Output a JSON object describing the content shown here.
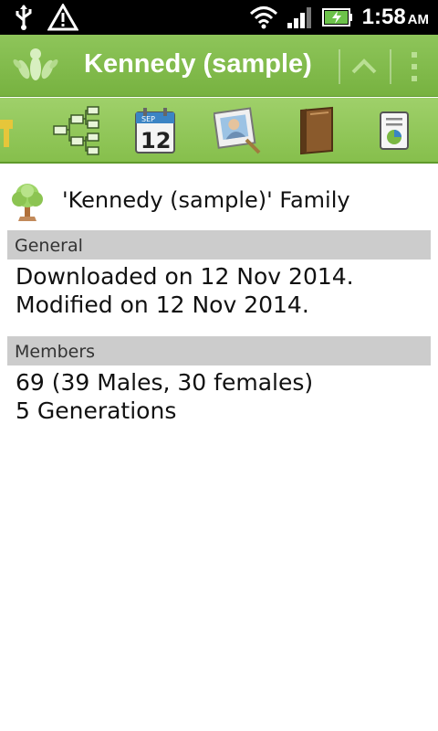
{
  "status_bar": {
    "time": "1:58",
    "ampm": "AM",
    "icons": [
      "usb-icon",
      "warning-icon",
      "wifi-icon",
      "signal-icon",
      "battery-charging-icon"
    ]
  },
  "title_bar": {
    "title": "Kennedy (sample)",
    "icons": [
      "app-logo-icon",
      "chevron-up-icon",
      "overflow-menu-icon"
    ]
  },
  "toolbar": {
    "tools": [
      "key-icon",
      "tree-chart-icon",
      "calendar-icon",
      "photo-icon",
      "book-icon",
      "report-icon"
    ],
    "calendar_month": "SEP",
    "calendar_day": "12"
  },
  "family": {
    "name": "'Kennedy (sample)' Family",
    "icon": "family-tree-icon"
  },
  "sections": {
    "general": {
      "header": "General",
      "lines": [
        "Downloaded on 12 Nov 2014.",
        "Modified on 12 Nov 2014."
      ]
    },
    "members": {
      "header": "Members",
      "lines": [
        "69 (39 Males, 30 females)",
        "5 Generations"
      ]
    }
  },
  "colors": {
    "accent": "#7ab843",
    "header_bg": "#cccccc"
  }
}
